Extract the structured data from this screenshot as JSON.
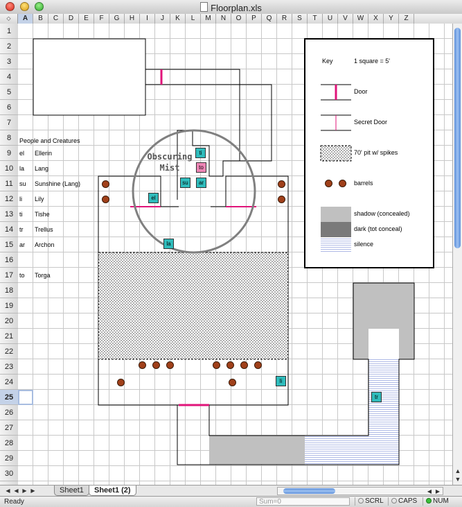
{
  "window": {
    "title": "Floorplan.xls"
  },
  "columns": [
    "A",
    "B",
    "C",
    "D",
    "E",
    "F",
    "G",
    "H",
    "I",
    "J",
    "K",
    "L",
    "M",
    "N",
    "O",
    "P",
    "Q",
    "R",
    "S",
    "T",
    "U",
    "V",
    "W",
    "X",
    "Y",
    "Z"
  ],
  "rows": [
    "1",
    "2",
    "3",
    "4",
    "5",
    "6",
    "7",
    "8",
    "9",
    "10",
    "11",
    "12",
    "13",
    "14",
    "15",
    "16",
    "17",
    "18",
    "19",
    "20",
    "21",
    "22",
    "23",
    "24",
    "25",
    "26",
    "27",
    "28",
    "29",
    "30"
  ],
  "selected_cell": {
    "column": "A",
    "row": "25"
  },
  "roster": {
    "heading": "People and Creatures",
    "entries": [
      {
        "code": "el",
        "name": "Ellerin"
      },
      {
        "code": "la",
        "name": "Lang"
      },
      {
        "code": "su",
        "name": "Sunshine (Lang)"
      },
      {
        "code": "li",
        "name": "Lily"
      },
      {
        "code": "ti",
        "name": "Tishe"
      },
      {
        "code": "tr",
        "name": "Trellus"
      },
      {
        "code": "ar",
        "name": "Archon"
      },
      {
        "code": "to",
        "name": "Torga"
      }
    ]
  },
  "map": {
    "mist_label_line1": "Obscuring",
    "mist_label_line2": "Mist",
    "tokens": {
      "ti": "ti",
      "to": "to",
      "su": "su",
      "ar": "ar",
      "el": "el",
      "la": "la",
      "li": "li",
      "tr": "tr"
    }
  },
  "legend": {
    "title": "Key",
    "scale": "1 square = 5'",
    "door": "Door",
    "secret_door": "Secret Door",
    "pit": "70' pit w/ spikes",
    "barrels": "barrels",
    "shadow": "shadow (concealed)",
    "dark": "dark (tot conceal)",
    "silence": "silence"
  },
  "colors": {
    "door": "#e0147a",
    "token": "#2fbcbc",
    "token_torga": "#ee86b6",
    "barrel": "#a0401a",
    "shadow": "#c0c0c0",
    "dark": "#7a7a7a",
    "silence": "#9ba8e0",
    "scroll_accent": "#5d8fd8"
  },
  "sheet_tabs": [
    "Sheet1",
    "Sheet1  (2)"
  ],
  "active_tab": 1,
  "status": {
    "ready": "Ready",
    "sum": "Sum=0",
    "scrl": "SCRL",
    "caps": "CAPS",
    "num": "NUM"
  },
  "icons": {
    "corner": "select-all-icon",
    "doc": "document-icon"
  }
}
